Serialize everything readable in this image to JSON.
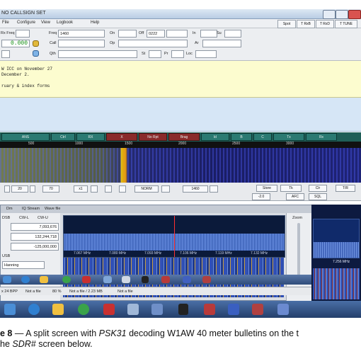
{
  "psk": {
    "title": "NO CALLSIGN SET",
    "menu": [
      "File",
      "Configure",
      "View",
      "Logbook",
      "Help"
    ],
    "right_buttons": [
      "Spot",
      "T RxB",
      "T RxD",
      "T TUNE"
    ],
    "form": {
      "freq_label": "Freq",
      "freq_value": "1460",
      "rxfreq_label": "Rx Freq",
      "on_label": "On",
      "off_label": "Off",
      "off_value": "0222",
      "in_label": "In",
      "sent_label": "Su",
      "call_label": "Call",
      "op_label": "Op",
      "ar_label": "Ar",
      "qth_label": "Qth",
      "st_label": "St",
      "pr_label": "Pr",
      "loc_label": "Loc",
      "freq_display": "0.000"
    },
    "rx_lines": [
      "W ICC on November 27",
      "December 2.",
      "",
      "ruary & index forms"
    ],
    "macros": [
      "ANS",
      "Ctrl",
      "RX",
      "X",
      "No Rpt",
      "Brag",
      "ld",
      "B",
      "C",
      "Tx",
      "Rx"
    ],
    "scale_ticks": [
      "500",
      "1000",
      "1500",
      "2000",
      "2500",
      "3000"
    ],
    "controls": [
      "20",
      "70",
      "x1",
      "NORM",
      "1460",
      "-2.0",
      "Store",
      "Tk",
      "AFC",
      "SQL",
      "Clr",
      "T/R"
    ]
  },
  "sdr": {
    "tabs": [
      "Dm",
      "IQ Stream",
      "Wave file"
    ],
    "left_values": [
      "7,093,676",
      "132,244,718",
      "-125,000,000"
    ],
    "left_labels": [
      "DSB",
      "CW-L",
      "CW-U",
      "USB",
      "Hanning"
    ],
    "zoom_label": "Zoom",
    "freq_ticks": [
      "7.067 MHz",
      "7.080 MHz",
      "7.093 MHz",
      "7.106 MHz",
      "7.119 MHz",
      "7.132 MHz"
    ],
    "right_freq": "7.256 MHz",
    "status": [
      "x 24 BPP",
      "Not a file",
      "80 %",
      "Not a file / 2.23 MB",
      "Not a file"
    ]
  },
  "caption": {
    "figure": "e 8",
    "line1_pre": " — A split screen with ",
    "line1_italic": "PSK31",
    "line1_post": " decoding W1AW 40 meter bulletins on the t",
    "line2_pre": "he ",
    "line2_italic": "SDR#",
    "line2_post": " screen below."
  }
}
